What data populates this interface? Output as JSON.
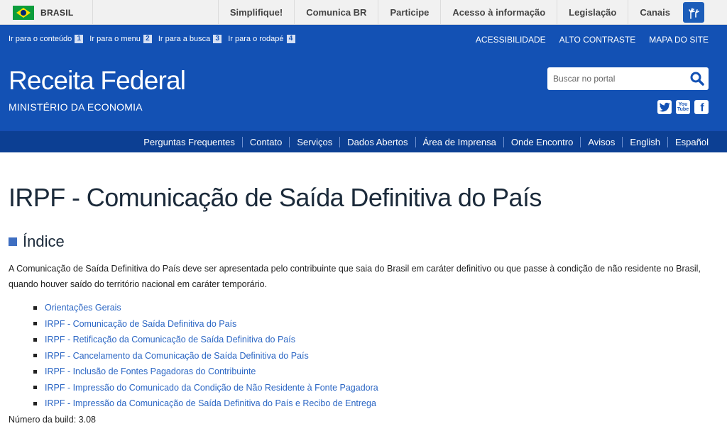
{
  "gov_bar": {
    "country_label": "BRASIL",
    "links": [
      "Simplifique!",
      "Comunica BR",
      "Participe",
      "Acesso à informação",
      "Legislação",
      "Canais"
    ],
    "vlibras_icon": "hands-sign-language-icon"
  },
  "header": {
    "accessibility": [
      {
        "label": "Ir para o conteúdo",
        "key": "1"
      },
      {
        "label": "Ir para o menu",
        "key": "2"
      },
      {
        "label": "Ir para a busca",
        "key": "3"
      },
      {
        "label": "Ir para o rodapé",
        "key": "4"
      }
    ],
    "top_links": [
      "ACESSIBILIDADE",
      "ALTO CONTRASTE",
      "MAPA DO SITE"
    ],
    "title": "Receita Federal",
    "subtitle": "MINISTÉRIO DA ECONOMIA",
    "search": {
      "placeholder": "Buscar no portal",
      "value": "",
      "icon": "search-icon"
    },
    "social": [
      {
        "name": "twitter-icon",
        "glyph": "t"
      },
      {
        "name": "youtube-icon",
        "glyph": "You Tube"
      },
      {
        "name": "facebook-icon",
        "glyph": "f"
      }
    ],
    "colors": {
      "primary": "#1351b4",
      "nav": "#0c3f93"
    }
  },
  "nav": {
    "items": [
      "Perguntas Frequentes",
      "Contato",
      "Serviços",
      "Dados Abertos",
      "Área de Imprensa",
      "Onde Encontro",
      "Avisos",
      "English",
      "Español"
    ]
  },
  "main": {
    "title": "IRPF - Comunicação de Saída Definitiva do País",
    "index_heading": "Índice",
    "intro": "A Comunicação de Saída Definitiva do País deve ser apresentada pelo contribuinte que saia do Brasil em caráter definitivo ou que passe à condição de não residente no Brasil, quando houver saído do território nacional em caráter temporário.",
    "links": [
      "Orientações Gerais",
      "IRPF - Comunicação de Saída Definitiva do País",
      "IRPF - Retificação da Comunicação de Saída Definitiva do País",
      "IRPF - Cancelamento da Comunicação de Saída Definitiva do País",
      "IRPF - Inclusão de Fontes Pagadoras do Contribuinte",
      "IRPF - Impressão do Comunicado da Condição de Não Residente à Fonte Pagadora",
      "IRPF - Impressão da Comunicação de Saída Definitiva do País e Recibo de Entrega"
    ],
    "build": "Número da build: 3.08"
  }
}
